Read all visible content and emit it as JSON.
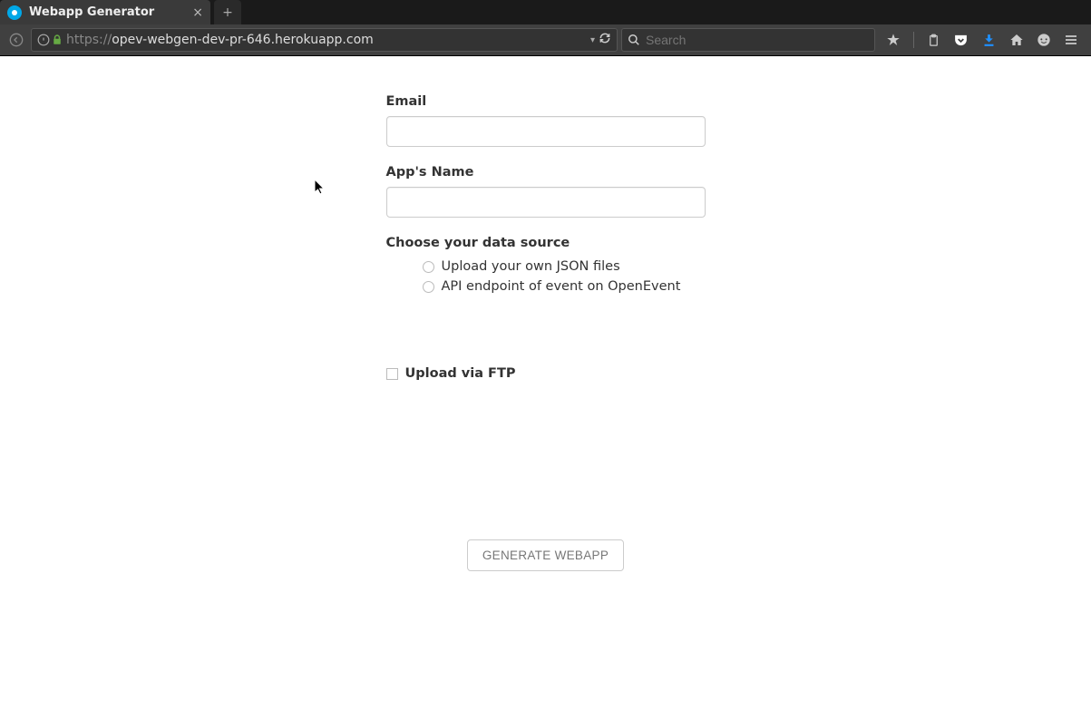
{
  "browser": {
    "tab_title": "Webapp Generator",
    "url_protocol": "https://",
    "url_host": "opev-webgen-dev-pr-646.herokuapp.com",
    "search_placeholder": "Search"
  },
  "form": {
    "email_label": "Email",
    "email_value": "",
    "appname_label": "App's Name",
    "appname_value": "",
    "datasource_label": "Choose your data source",
    "radio_upload_json": "Upload your own JSON files",
    "radio_api_endpoint": "API endpoint of event on OpenEvent",
    "ftp_label": "Upload via FTP",
    "generate_label": "GENERATE WEBAPP"
  }
}
